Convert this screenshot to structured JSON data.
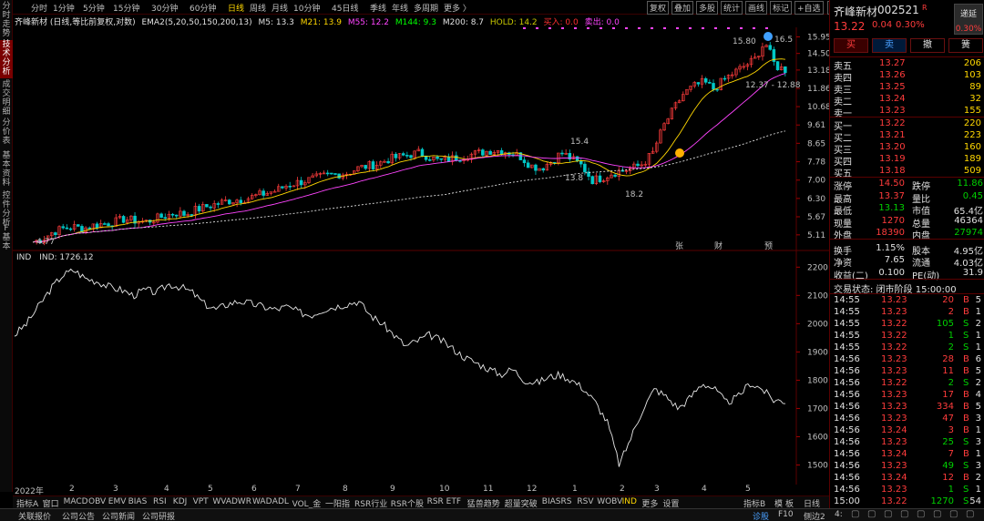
{
  "left_tabs": [
    {
      "label": "分时走势",
      "active": false
    },
    {
      "label": "技术分析",
      "active": true
    },
    {
      "label": "成交明细",
      "active": false
    },
    {
      "label": "分价表",
      "active": false
    },
    {
      "label": "基本资料",
      "active": false
    },
    {
      "label": "控件分析",
      "active": false
    },
    {
      "label": "F基本",
      "active": false
    }
  ],
  "periods": [
    "分时",
    "1分钟",
    "5分钟",
    "15分钟",
    "30分钟",
    "60分钟",
    "日线",
    "周线",
    "月线",
    "10分钟",
    "45日线",
    "季线",
    "年线",
    "多周期",
    "更多 〉"
  ],
  "active_period": "日线",
  "toolbar": [
    "复权",
    "叠加",
    "多股",
    "统计",
    "画线",
    "标记",
    "+自选",
    "返回"
  ],
  "indicator_line": {
    "title": "齐峰新材 (日线,等比前复权,对数)",
    "ema": "EMA2(5,20,50,150,200,13)",
    "m5": "M5: 13.3",
    "m21": "M21: 13.9",
    "m55": "M55: 12.2",
    "m144": "M144: 9.3",
    "m200": "M200: 8.7",
    "hold": "HOLD: 14.2",
    "buy": "买入: 0.0",
    "sell": "卖出: 0.0",
    "colors": {
      "m5": "#e0e0e0",
      "m21": "#ffd700",
      "m55": "#ff44ff",
      "m144": "#00ff00",
      "m200": "#e0e0e0",
      "hold": "#c8c800",
      "buy": "#ff3030",
      "sell": "#ff44ff"
    }
  },
  "annotations": {
    "high": "15.80",
    "high2": "16.5",
    "range": "12.37 - 12.88",
    "low_start": "4.77",
    "mid1": "15.4",
    "mid2": "13.8",
    "mid3": "18.2",
    "mk1": "张",
    "mk2": "财",
    "mk3": "预"
  },
  "chart_data": [
    {
      "type": "line",
      "title": "齐峰新材 (日线,等比前复权,对数)",
      "y_axis_ticks": [
        "15.95",
        "14.50",
        "13.18",
        "11.86",
        "10.68",
        "9.61",
        "8.65",
        "7.78",
        "7.00",
        "6.30",
        "5.67",
        "5.11"
      ],
      "ylim": [
        5.0,
        16.5
      ],
      "scale": "log",
      "approx_close": [
        4.9,
        5.0,
        5.2,
        5.3,
        5.35,
        5.3,
        5.4,
        5.45,
        5.5,
        5.6,
        5.55,
        5.5,
        5.6,
        5.7,
        5.8,
        5.75,
        5.9,
        6.0,
        6.1,
        6.2,
        6.25,
        6.3,
        6.4,
        6.5,
        6.6,
        6.8,
        6.9,
        7.0,
        7.1,
        7.2,
        7.25,
        7.3,
        7.5,
        7.6,
        7.7,
        7.9,
        8.0,
        8.1,
        8.2,
        8.0,
        7.8,
        7.9,
        8.0,
        8.1,
        8.2,
        8.3,
        8.3,
        8.2,
        8.0,
        7.6,
        7.5,
        7.8,
        8.2,
        7.9,
        7.6,
        7.0,
        7.1,
        7.3,
        7.4,
        7.5,
        7.7,
        8.2,
        9.5,
        10.5,
        11.5,
        12.0,
        12.3,
        11.8,
        12.5,
        13.0,
        13.5,
        14.0,
        15.5,
        13.5,
        13.2
      ]
    },
    {
      "type": "line",
      "title": "IND",
      "series": [
        {
          "name": "IND",
          "last": 1726.12
        }
      ],
      "y_axis_ticks": [
        "2200",
        "2100",
        "2000",
        "1900",
        "1800",
        "1700",
        "1600",
        "1500"
      ],
      "ylim": [
        1450,
        2230
      ],
      "approx_values": [
        1960,
        2000,
        2060,
        2120,
        2170,
        2190,
        2160,
        2150,
        2130,
        2120,
        2100,
        2120,
        2110,
        2140,
        2130,
        2110,
        2070,
        2050,
        2070,
        2080,
        2070,
        2060,
        2050,
        2060,
        2040,
        2030,
        2050,
        2060,
        2070,
        2080,
        2030,
        2000,
        1960,
        1920,
        1940,
        1960,
        1940,
        1910,
        1880,
        1860,
        1840,
        1820,
        1840,
        1800,
        1790,
        1810,
        1820,
        1800,
        1770,
        1720,
        1650,
        1500,
        1600,
        1700,
        1770,
        1740,
        1700,
        1740,
        1790,
        1770,
        1720,
        1740,
        1790,
        1770,
        1730,
        1726
      ]
    }
  ],
  "x_axis": [
    "2022年",
    "2",
    "3",
    "4",
    "5",
    "6",
    "7",
    "8",
    "9",
    "10",
    "11",
    "12",
    "1",
    "2",
    "3",
    "4",
    "5"
  ],
  "bottom_tabs": [
    "指标A",
    "窗口",
    "MACD",
    "OBV",
    "EMV",
    "BIAS",
    "RSI",
    "KDJ",
    "VPT",
    "WVAD",
    "WR",
    "WAD",
    "ADL",
    "VOL_金",
    "一阳指",
    "RSR行业",
    "RSR个股",
    "RSR ETF",
    "猛兽趋势",
    "超量突破",
    "BIASRS",
    "RSV",
    "WOBV",
    "IND",
    "更多",
    "设置"
  ],
  "active_bottom_tab": "IND",
  "bottom_right": [
    "指标B",
    "模",
    "板",
    "日线"
  ],
  "status_bar": [
    "关联报价",
    "公司公告",
    "公司新闻",
    "公司研报"
  ],
  "status_right": [
    "诊股",
    "F10",
    "侧边2",
    "4:"
  ],
  "right_panel": {
    "name": "齐峰新材",
    "code": "002521",
    "r_mark": "R",
    "price": "13.22",
    "change": "0.04",
    "pct": "0.30%",
    "tag": "递延",
    "tag_pct": "0.30%",
    "actions": [
      "买",
      "卖",
      "撤",
      "簧"
    ],
    "asks": [
      {
        "label": "卖五",
        "price": "13.27",
        "vol": "206"
      },
      {
        "label": "卖四",
        "price": "13.26",
        "vol": "103"
      },
      {
        "label": "卖三",
        "price": "13.25",
        "vol": "89"
      },
      {
        "label": "卖二",
        "price": "13.24",
        "vol": "32"
      },
      {
        "label": "卖一",
        "price": "13.23",
        "vol": "155"
      }
    ],
    "bids": [
      {
        "label": "买一",
        "price": "13.22",
        "vol": "220"
      },
      {
        "label": "买二",
        "price": "13.21",
        "vol": "223"
      },
      {
        "label": "买三",
        "price": "13.20",
        "vol": "160"
      },
      {
        "label": "买四",
        "price": "13.19",
        "vol": "189"
      },
      {
        "label": "买五",
        "price": "13.18",
        "vol": "509"
      }
    ],
    "stats": [
      {
        "l1": "涨停",
        "v1": "14.50",
        "c1": "red",
        "l2": "跌停",
        "v2": "11.86",
        "c2": "green"
      },
      {
        "l1": "最高",
        "v1": "13.37",
        "c1": "red",
        "l2": "量比",
        "v2": "0.45",
        "c2": "green"
      },
      {
        "l1": "最低",
        "v1": "13.13",
        "c1": "green",
        "l2": "市值",
        "v2": "65.4亿",
        "c2": "white"
      },
      {
        "l1": "现量",
        "v1": "1270",
        "c1": "red",
        "l2": "总量",
        "v2": "46364",
        "c2": "white"
      },
      {
        "l1": "外盘",
        "v1": "18390",
        "c1": "red",
        "l2": "内盘",
        "v2": "27974",
        "c2": "green"
      },
      {
        "l1": "换手",
        "v1": "1.15%",
        "c1": "white",
        "l2": "股本",
        "v2": "4.95亿",
        "c2": "white"
      },
      {
        "l1": "净资",
        "v1": "7.65",
        "c1": "white",
        "l2": "流通",
        "v2": "4.03亿",
        "c2": "white"
      },
      {
        "l1": "收益(二)",
        "v1": "0.100",
        "c1": "white",
        "l2": "PE(动)",
        "v2": "31.9",
        "c2": "white"
      }
    ],
    "trade_state": "交易状态: 闭市阶段 15:00:00",
    "ticks": [
      {
        "t": "14:55",
        "p": "13.23",
        "v": "20",
        "s": "B",
        "n": "5"
      },
      {
        "t": "14:55",
        "p": "13.23",
        "v": "2",
        "s": "B",
        "n": "1"
      },
      {
        "t": "14:55",
        "p": "13.22",
        "v": "105",
        "s": "S",
        "n": "2"
      },
      {
        "t": "14:55",
        "p": "13.22",
        "v": "1",
        "s": "S",
        "n": "1"
      },
      {
        "t": "14:55",
        "p": "13.22",
        "v": "2",
        "s": "S",
        "n": "1"
      },
      {
        "t": "14:56",
        "p": "13.23",
        "v": "28",
        "s": "B",
        "n": "6"
      },
      {
        "t": "14:56",
        "p": "13.23",
        "v": "11",
        "s": "B",
        "n": "5"
      },
      {
        "t": "14:56",
        "p": "13.22",
        "v": "2",
        "s": "S",
        "n": "2"
      },
      {
        "t": "14:56",
        "p": "13.23",
        "v": "17",
        "s": "B",
        "n": "4"
      },
      {
        "t": "14:56",
        "p": "13.23",
        "v": "334",
        "s": "B",
        "n": "5"
      },
      {
        "t": "14:56",
        "p": "13.23",
        "v": "47",
        "s": "B",
        "n": "3"
      },
      {
        "t": "14:56",
        "p": "13.24",
        "v": "3",
        "s": "B",
        "n": "1"
      },
      {
        "t": "14:56",
        "p": "13.23",
        "v": "25",
        "s": "S",
        "n": "3"
      },
      {
        "t": "14:56",
        "p": "13.24",
        "v": "7",
        "s": "B",
        "n": "1"
      },
      {
        "t": "14:56",
        "p": "13.23",
        "v": "49",
        "s": "S",
        "n": "3"
      },
      {
        "t": "14:56",
        "p": "13.24",
        "v": "12",
        "s": "B",
        "n": "2"
      },
      {
        "t": "14:56",
        "p": "13.23",
        "v": "1",
        "s": "S",
        "n": "1"
      },
      {
        "t": "15:00",
        "p": "13.22",
        "v": "1270",
        "s": "S",
        "n": "54"
      }
    ]
  }
}
